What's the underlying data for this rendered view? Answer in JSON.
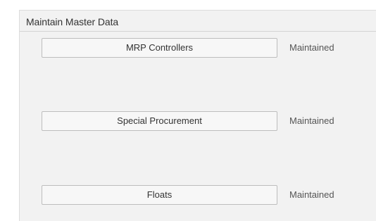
{
  "section": {
    "title": "Maintain Master Data"
  },
  "rows": [
    {
      "label": "MRP Controllers",
      "status": "Maintained"
    },
    {
      "label": "Special Procurement",
      "status": "Maintained"
    },
    {
      "label": "Floats",
      "status": "Maintained"
    }
  ]
}
